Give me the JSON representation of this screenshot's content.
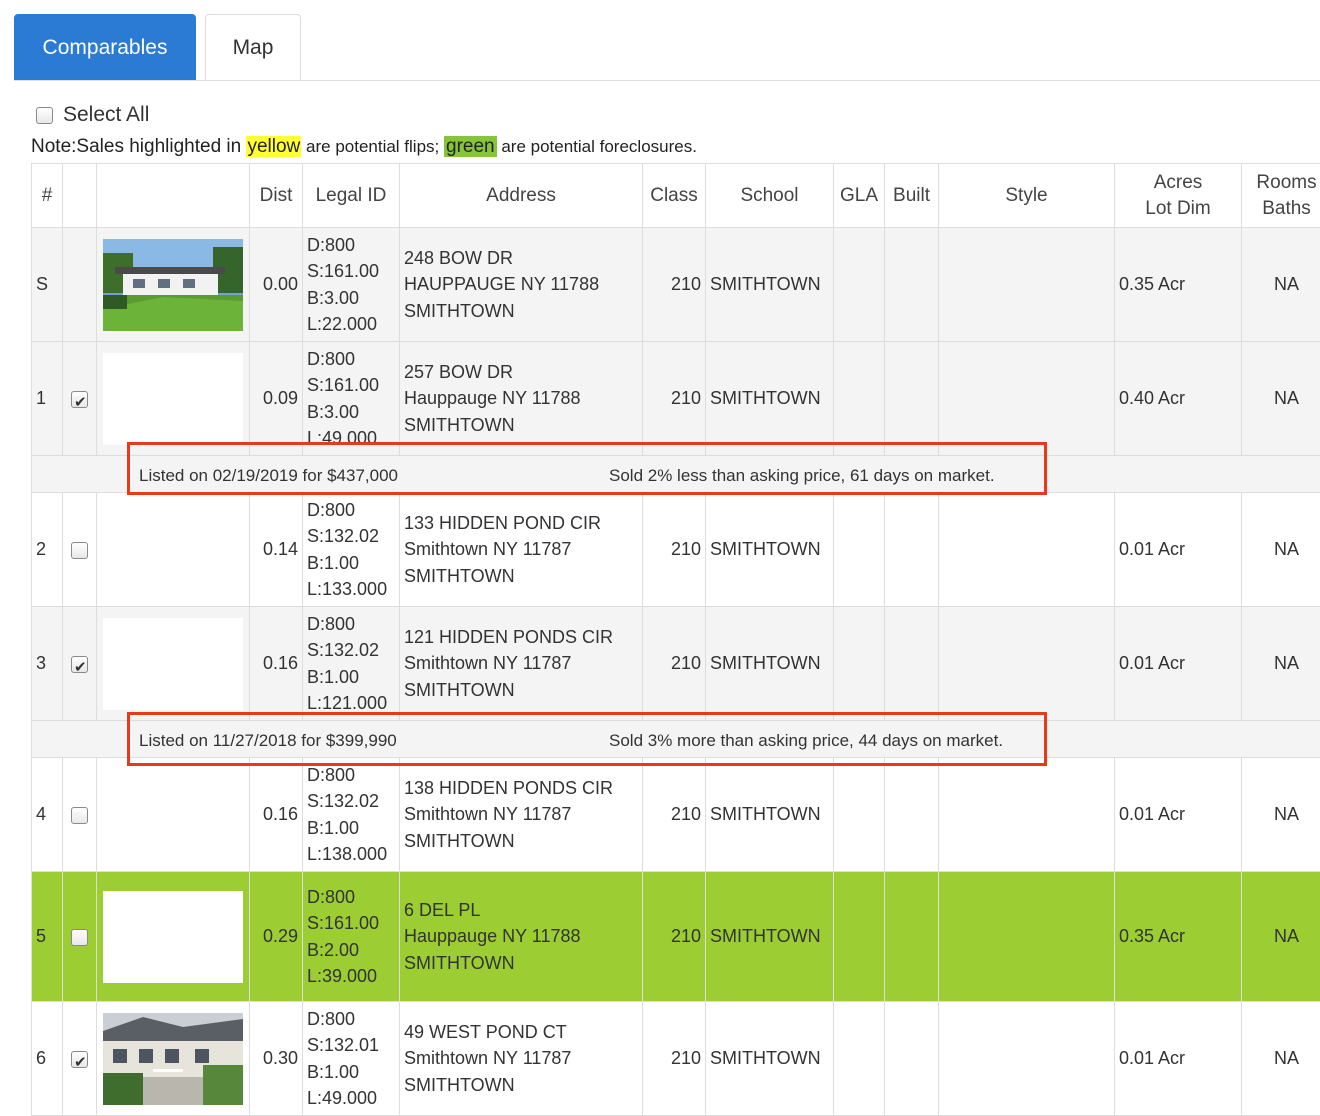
{
  "tabs": [
    {
      "label": "Comparables",
      "active": true
    },
    {
      "label": "Map",
      "active": false
    }
  ],
  "select_all": {
    "label": "Select All",
    "checked": false
  },
  "note": {
    "prefix": "Note:Sales highlighted in ",
    "yellow_word": "yellow",
    "middle": " are potential flips; ",
    "green_word": "green",
    "suffix": " are potential foreclosures."
  },
  "colors": {
    "tab_active": "#2b7bd5",
    "highlight_yellow": "#ffff33",
    "highlight_green": "#86c43a",
    "row_green": "#9ccd32",
    "callout_red": "#e8391b"
  },
  "table": {
    "headers": {
      "num": "#",
      "select": "",
      "photo": "",
      "dist": "Dist",
      "legal_id": "Legal ID",
      "address": "Address",
      "class": "Class",
      "school": "School",
      "gla": "GLA",
      "built": "Built",
      "style": "Style",
      "acres_line1": "Acres",
      "acres_line2": "Lot Dim",
      "rooms_line1": "Rooms",
      "rooms_line2": "Baths"
    },
    "rows": [
      {
        "num": "S",
        "checkbox": null,
        "photo": "house-exterior-photo",
        "dist": "0.00",
        "legal": [
          "D:800",
          "S:161.00",
          "B:3.00",
          "L:22.000"
        ],
        "address": [
          "248 BOW DR",
          "HAUPPAUGE NY 11788",
          "SMITHTOWN"
        ],
        "class": "210",
        "school": "SMITHTOWN",
        "gla": "",
        "built": "",
        "style": "",
        "acres": "0.35 Acr",
        "rooms": "NA"
      },
      {
        "num": "1",
        "checkbox": true,
        "photo": "blank",
        "dist": "0.09",
        "legal": [
          "D:800",
          "S:161.00",
          "B:3.00",
          "L:49.000"
        ],
        "address": [
          "257 BOW DR",
          "Hauppauge NY 11788",
          "SMITHTOWN"
        ],
        "class": "210",
        "school": "SMITHTOWN",
        "gla": "",
        "built": "",
        "style": "",
        "acres": "0.40 Acr",
        "rooms": "NA",
        "listing": {
          "left": "Listed on 02/19/2019 for $437,000",
          "right": "Sold 2% less than asking price, 61 days on market."
        }
      },
      {
        "num": "2",
        "checkbox": false,
        "photo": "none",
        "dist": "0.14",
        "legal": [
          "D:800",
          "S:132.02",
          "B:1.00",
          "L:133.000"
        ],
        "address": [
          "133 HIDDEN POND CIR",
          "Smithtown NY 11787",
          "SMITHTOWN"
        ],
        "class": "210",
        "school": "SMITHTOWN",
        "gla": "",
        "built": "",
        "style": "",
        "acres": "0.01 Acr",
        "rooms": "NA"
      },
      {
        "num": "3",
        "checkbox": true,
        "photo": "blank",
        "dist": "0.16",
        "legal": [
          "D:800",
          "S:132.02",
          "B:1.00",
          "L:121.000"
        ],
        "address": [
          "121 HIDDEN PONDS CIR",
          "Smithtown NY 11787",
          "SMITHTOWN"
        ],
        "class": "210",
        "school": "SMITHTOWN",
        "gla": "",
        "built": "",
        "style": "",
        "acres": "0.01 Acr",
        "rooms": "NA",
        "listing": {
          "left": "Listed on 11/27/2018 for $399,990",
          "right": "Sold 3% more than asking price, 44 days on market."
        }
      },
      {
        "num": "4",
        "checkbox": false,
        "photo": "none",
        "dist": "0.16",
        "legal": [
          "D:800",
          "S:132.02",
          "B:1.00",
          "L:138.000"
        ],
        "address": [
          "138 HIDDEN PONDS CIR",
          "Smithtown NY 11787",
          "SMITHTOWN"
        ],
        "class": "210",
        "school": "SMITHTOWN",
        "gla": "",
        "built": "",
        "style": "",
        "acres": "0.01 Acr",
        "rooms": "NA"
      },
      {
        "num": "5",
        "checkbox": false,
        "photo": "blank",
        "dist": "0.29",
        "legal": [
          "D:800",
          "S:161.00",
          "B:2.00",
          "L:39.000"
        ],
        "address": [
          "6 DEL PL",
          "Hauppauge NY 11788",
          "SMITHTOWN"
        ],
        "class": "210",
        "school": "SMITHTOWN",
        "gla": "",
        "built": "",
        "style": "",
        "acres": "0.35 Acr",
        "rooms": "NA",
        "highlight": "green"
      },
      {
        "num": "6",
        "checkbox": true,
        "photo": "townhouse-photo",
        "dist": "0.30",
        "legal": [
          "D:800",
          "S:132.01",
          "B:1.00",
          "L:49.000"
        ],
        "address": [
          "49 WEST POND CT",
          "Smithtown NY 11787",
          "SMITHTOWN"
        ],
        "class": "210",
        "school": "SMITHTOWN",
        "gla": "",
        "built": "",
        "style": "",
        "acres": "0.01 Acr",
        "rooms": "NA"
      }
    ]
  }
}
